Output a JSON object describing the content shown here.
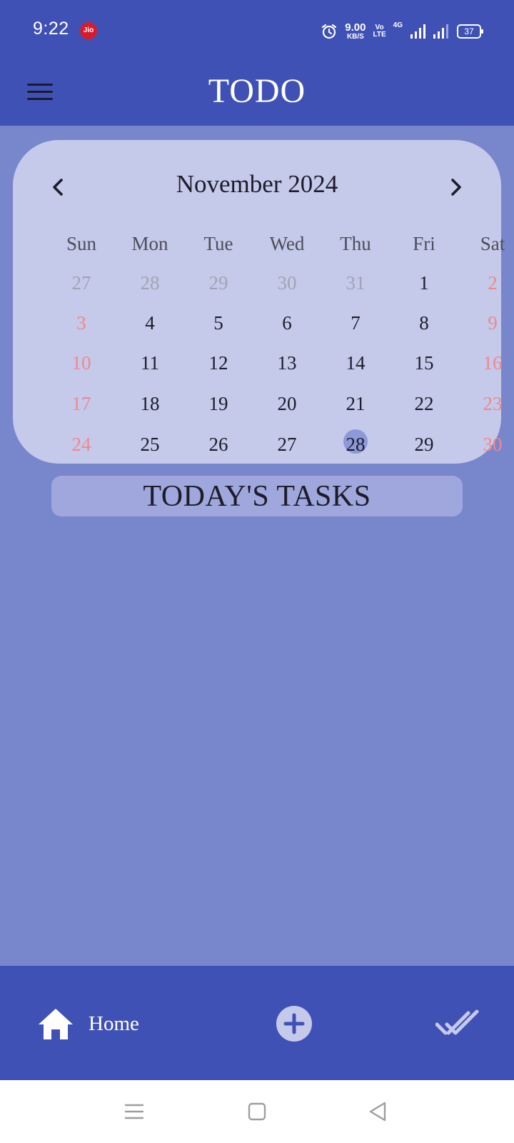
{
  "status_bar": {
    "time": "9:22",
    "carrier_badge": "Jio",
    "speed_value": "9.00",
    "speed_unit": "KB/S",
    "volte_top": "Vo",
    "volte_bottom": "LTE",
    "network_type": "4G",
    "battery": "37",
    "icons": [
      "alarm-icon",
      "signal-icon",
      "signal-icon",
      "battery-icon"
    ]
  },
  "app_bar": {
    "title": "TODO",
    "menu_icon": "hamburger-menu-icon"
  },
  "calendar": {
    "month_label": "November 2024",
    "prev_icon": "chevron-left-icon",
    "next_icon": "chevron-right-icon",
    "weekdays": [
      "Sun",
      "Mon",
      "Tue",
      "Wed",
      "Thu",
      "Fri",
      "Sat"
    ],
    "weeks": [
      [
        "27",
        "28",
        "29",
        "30",
        "31",
        "1",
        "2"
      ],
      [
        "3",
        "4",
        "5",
        "6",
        "7",
        "8",
        "9"
      ],
      [
        "10",
        "11",
        "12",
        "13",
        "14",
        "15",
        "16"
      ],
      [
        "17",
        "18",
        "19",
        "20",
        "21",
        "22",
        "23"
      ],
      [
        "24",
        "25",
        "26",
        "27",
        "28",
        "29",
        "30"
      ]
    ],
    "outside_month_days": [
      "27",
      "28",
      "29",
      "30",
      "31"
    ],
    "selected_day": "28",
    "colors": {
      "weekend": "#f0888c",
      "outside": "#a2a4b4",
      "selected": "#8d99d8"
    }
  },
  "tasks": {
    "header": "TODAY'S TASKS"
  },
  "bottom_nav": {
    "home_label": "Home",
    "home_icon": "home-icon",
    "add_icon": "add-icon",
    "done_icon": "double-check-icon"
  },
  "system_nav": {
    "icons": [
      "recents-icon",
      "home-square-icon",
      "back-icon"
    ]
  },
  "colors": {
    "primary": "#3f51b5",
    "background": "#7886cb",
    "card": "#c5c9ea",
    "tasks_header": "#9fa7dc"
  }
}
